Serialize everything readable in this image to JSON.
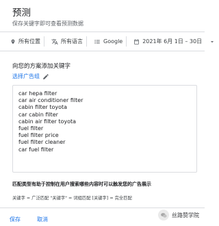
{
  "header": {
    "title": "预测",
    "subtitle": "保存关键字即可查看预测数据"
  },
  "filters": {
    "location": "所有位置",
    "language": "所有语言",
    "network": "Google",
    "date_range": "2021年 6月 1日 – 30日"
  },
  "section": {
    "title": "向您的方案添加关键字",
    "group_link": "选择广告组"
  },
  "keywords": [
    "car hepa filter",
    "car air conditioner filter",
    "cabin filter toyota",
    "car cabin filter",
    "cabin air filter toyota",
    "fuel filter",
    "fuel filter price",
    "fuel filter cleaner",
    "car fuel filter"
  ],
  "help": {
    "note": "匹配类型有助于控制在用户搜索哪些内容时可以触发您的广告展示",
    "syntax": "关键字 = 广泛匹配  \"关键字\" = 词组匹配  [关键字] = 完全匹配"
  },
  "actions": {
    "save": "保存",
    "cancel": "取消"
  },
  "watermark": {
    "text": "丝路赞学院"
  },
  "colors": {
    "accent": "#1a73e8",
    "divider": "#dadce0",
    "text_secondary": "#5f6368"
  }
}
